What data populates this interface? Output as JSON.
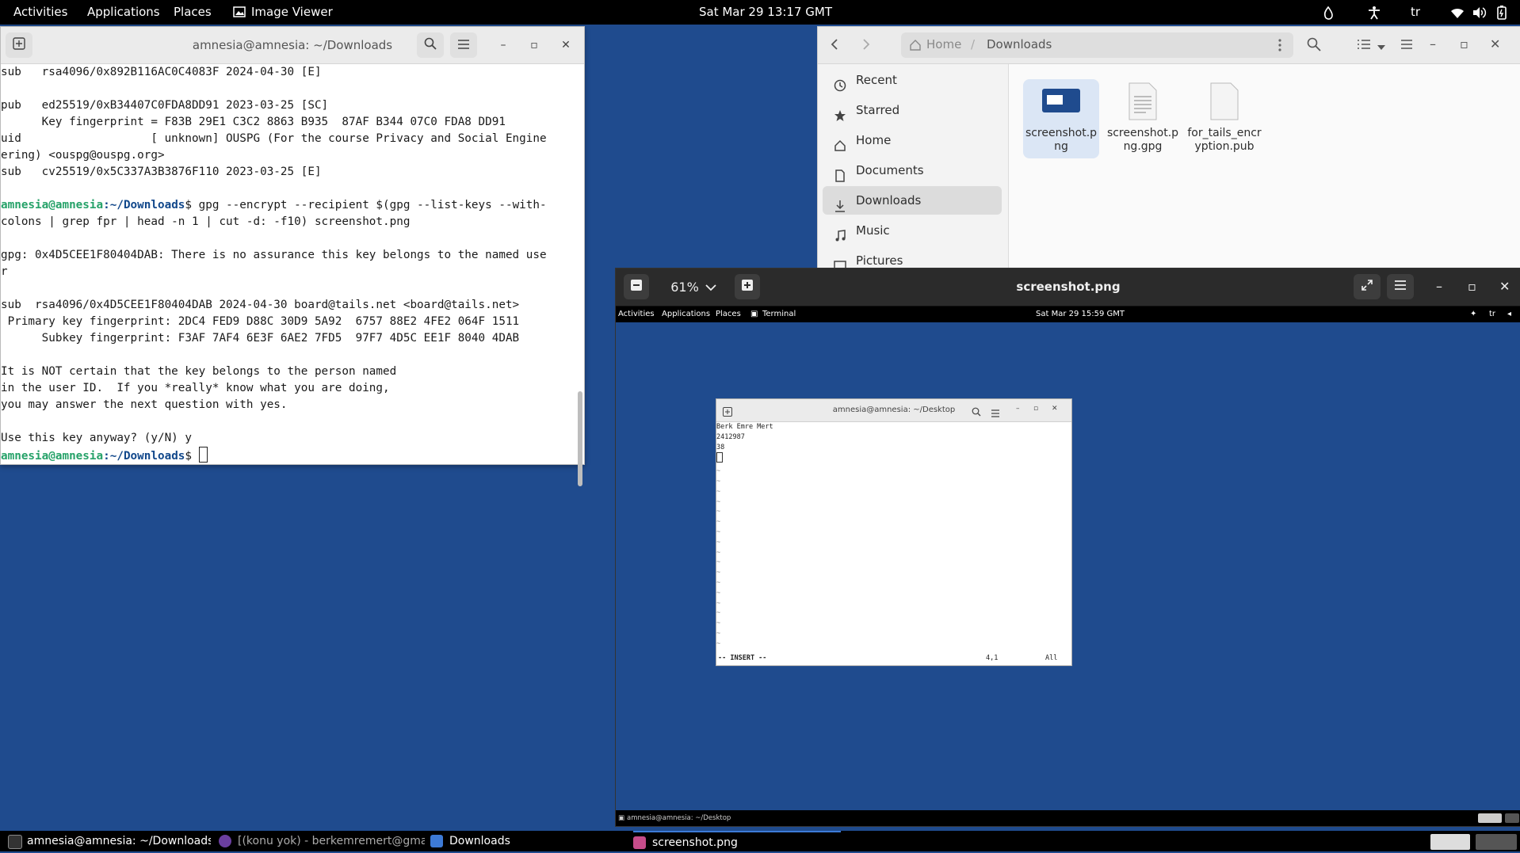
{
  "topbar": {
    "activities": "Activities",
    "applications": "Applications",
    "places": "Places",
    "image_viewer": "Image Viewer",
    "clock": "Sat Mar 29  13:17 GMT",
    "keyboard": "tr"
  },
  "terminal": {
    "title": "amnesia@amnesia: ~/Downloads",
    "lines": [
      "sub   rsa4096/0x892B116AC0C4083F 2024-04-30 [E]",
      "",
      "pub   ed25519/0xB34407C0FDA8DD91 2023-03-25 [SC]",
      "      Key fingerprint = F83B 29E1 C3C2 8863 B935  87AF B344 07C0 FDA8 DD91",
      "uid                   [ unknown] OUSPG (For the course Privacy and Social Engine",
      "ering) <ouspg@ouspg.org>",
      "sub   cv25519/0x5C337A3B3876F110 2023-03-25 [E]",
      ""
    ],
    "prompt_user": "amnesia@amnesia",
    "prompt_path": ":~/Downloads",
    "command_1": "$ gpg --encrypt --recipient $(gpg --list-keys --with-",
    "command_1b": "colons | grep fpr | head -n 1 | cut -d: -f10) screenshot.png",
    "lines2": [
      "",
      "gpg: 0x4D5CEE1F80404DAB: There is no assurance this key belongs to the named use",
      "r",
      "",
      "sub  rsa4096/0x4D5CEE1F80404DAB 2024-04-30 board@tails.net <board@tails.net>",
      " Primary key fingerprint: 2DC4 FED9 D88C 30D9 5A92  6757 88E2 4FE2 064F 1511",
      "      Subkey fingerprint: F3AF 7AF4 6E3F 6AE2 7FD5  97F7 4D5C EE1F 8040 4DAB",
      "",
      "It is NOT certain that the key belongs to the person named",
      "in the user ID.  If you *really* know what you are doing,",
      "you may answer the next question with yes.",
      "",
      "Use this key anyway? (y/N) y"
    ],
    "final_prompt_suffix": "$ "
  },
  "files": {
    "breadcrumb_home": "Home",
    "breadcrumb_current": "Downloads",
    "sidebar": [
      "Recent",
      "Starred",
      "Home",
      "Documents",
      "Downloads",
      "Music",
      "Pictures"
    ],
    "items": [
      "screenshot.png",
      "screenshot.png.gpg",
      "for_tails_encryption.pub"
    ]
  },
  "viewer": {
    "zoom": "61%",
    "title": "screenshot.png",
    "inner": {
      "activities": "Activities",
      "applications": "Applications",
      "places": "Places",
      "terminal": "Terminal",
      "clock": "Sat Mar 29  15:59 GMT",
      "keyboard": "tr",
      "term_title": "amnesia@amnesia: ~/Desktop",
      "lines": [
        "Berk Emre Mert",
        "2412987",
        "38"
      ],
      "status_mode": "-- INSERT --",
      "status_pos": "4,1",
      "status_all": "All",
      "bottom_task": "amnesia@amnesia: ~/Desktop"
    }
  },
  "taskbar": {
    "items": [
      "amnesia@amnesia: ~/Downloads",
      "[(konu yok) - berkemremert@gma...",
      "Downloads",
      "screenshot.png"
    ]
  }
}
